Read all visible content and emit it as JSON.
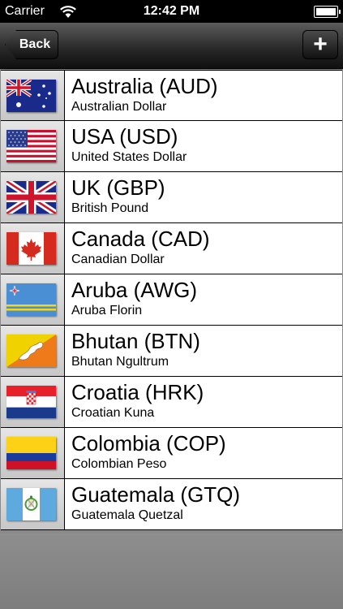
{
  "status_bar": {
    "carrier": "Carrier",
    "time": "12:42 PM"
  },
  "nav": {
    "back_label": "Back",
    "add_label": "+"
  },
  "currencies": [
    {
      "name": "Australia (AUD)",
      "subtitle": "Australian Dollar",
      "flag": "australia-flag"
    },
    {
      "name": "USA (USD)",
      "subtitle": "United States Dollar",
      "flag": "usa-flag"
    },
    {
      "name": "UK (GBP)",
      "subtitle": "British Pound",
      "flag": "uk-flag"
    },
    {
      "name": "Canada (CAD)",
      "subtitle": "Canadian Dollar",
      "flag": "canada-flag"
    },
    {
      "name": "Aruba (AWG)",
      "subtitle": "Aruba Florin",
      "flag": "aruba-flag"
    },
    {
      "name": "Bhutan (BTN)",
      "subtitle": "Bhutan Ngultrum",
      "flag": "bhutan-flag"
    },
    {
      "name": "Croatia (HRK)",
      "subtitle": "Croatian Kuna",
      "flag": "croatia-flag"
    },
    {
      "name": "Colombia (COP)",
      "subtitle": "Colombian Peso",
      "flag": "colombia-flag"
    },
    {
      "name": "Guatemala (GTQ)",
      "subtitle": "Guatemala Quetzal",
      "flag": "guatemala-flag"
    }
  ]
}
